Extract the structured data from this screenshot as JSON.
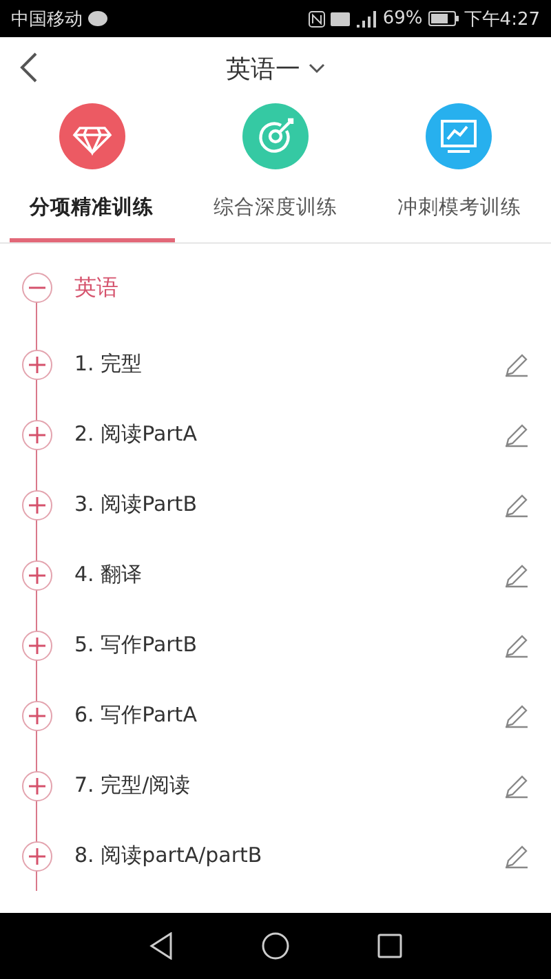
{
  "status_bar": {
    "carrier": "中国移动",
    "battery_text": "69%",
    "time": "下午4:27"
  },
  "header": {
    "title": "英语一"
  },
  "tabs": [
    {
      "label": "分项精准训练",
      "kind": "diamond",
      "selected": true
    },
    {
      "label": "综合深度训练",
      "kind": "target",
      "selected": false
    },
    {
      "label": "冲刺模考训练",
      "kind": "monitor",
      "selected": false
    }
  ],
  "tree": {
    "label": "英语",
    "expanded": true,
    "children": [
      {
        "label": "1. 完型",
        "expanded": false
      },
      {
        "label": "2. 阅读PartA",
        "expanded": false
      },
      {
        "label": "3. 阅读PartB",
        "expanded": false
      },
      {
        "label": "4. 翻译",
        "expanded": false
      },
      {
        "label": "5. 写作PartB",
        "expanded": false
      },
      {
        "label": "6. 写作PartA",
        "expanded": false
      },
      {
        "label": "7. 完型/阅读",
        "expanded": false
      },
      {
        "label": "8. 阅读partA/partB",
        "expanded": false
      }
    ]
  }
}
